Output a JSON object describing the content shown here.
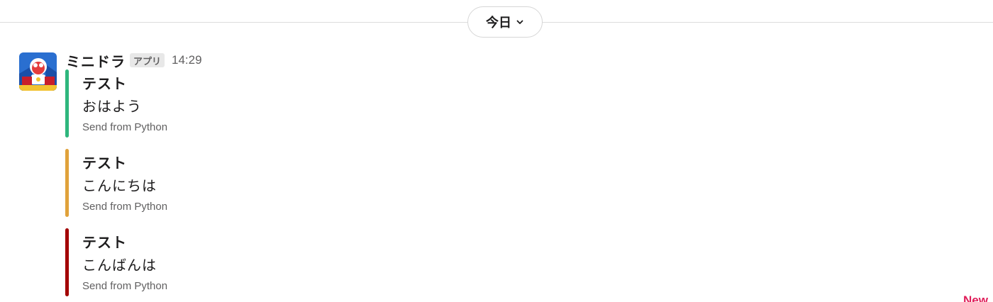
{
  "date_divider": {
    "label": "今日",
    "icon": "chevron-down-icon"
  },
  "message": {
    "sender": "ミニドラ",
    "badge": "アプリ",
    "time": "14:29",
    "avatar_icon": "avatar-image",
    "attachments": [
      {
        "title": "テスト",
        "text": "おはよう",
        "footer": "Send from Python",
        "color": "#2eb67d"
      },
      {
        "title": "テスト",
        "text": "こんにちは",
        "footer": "Send from Python",
        "color": "#e0a23b"
      },
      {
        "title": "テスト",
        "text": "こんばんは",
        "footer": "Send from Python",
        "color": "#a30200"
      }
    ]
  },
  "new_marker": "New"
}
